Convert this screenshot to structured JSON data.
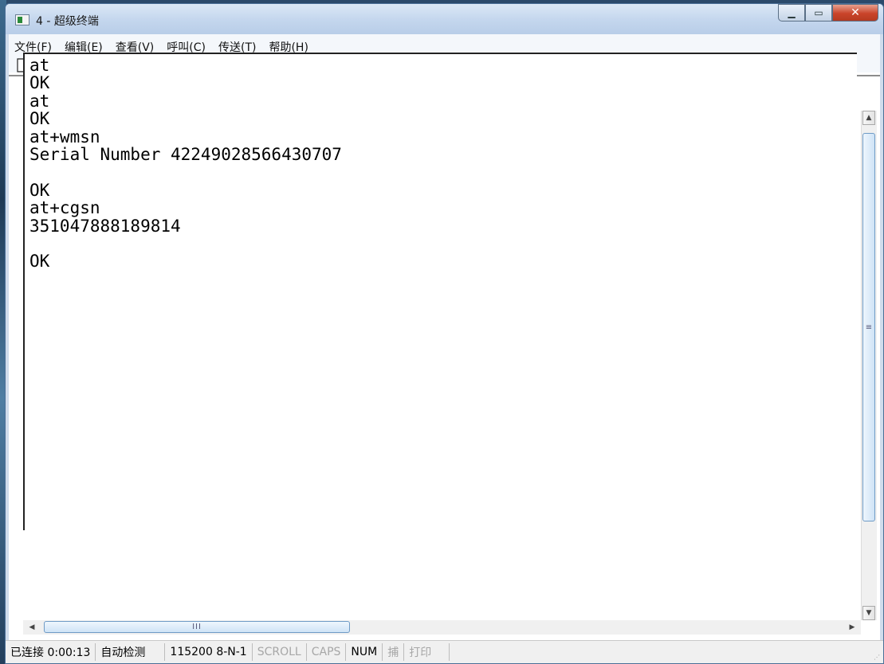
{
  "window": {
    "title": "4 - 超级终端"
  },
  "menubar": {
    "items": [
      "文件(F)",
      "编辑(E)",
      "查看(V)",
      "呼叫(C)",
      "传送(T)",
      "帮助(H)"
    ]
  },
  "toolbar": {
    "icons": [
      "new-file-icon",
      "open-folder-icon",
      "call-phone-icon",
      "disconnect-phone-icon",
      "send-file-icon",
      "receive-file-icon",
      "properties-icon"
    ]
  },
  "terminal": {
    "lines": [
      "at",
      "OK",
      "at",
      "OK",
      "at+wmsn",
      "Serial Number 42249028566430707",
      "",
      "OK",
      "at+cgsn",
      "351047888189814",
      "",
      "OK"
    ]
  },
  "scrollbars": {
    "h_thumb_glyph": "III",
    "v_thumb_glyph": "≡"
  },
  "statusbar": {
    "connection": "已连接 0:00:13",
    "detect": "自动检测",
    "settings": "115200 8-N-1",
    "scroll": "SCROLL",
    "caps": "CAPS",
    "num": "NUM",
    "capture": "捕",
    "print": "打印"
  }
}
